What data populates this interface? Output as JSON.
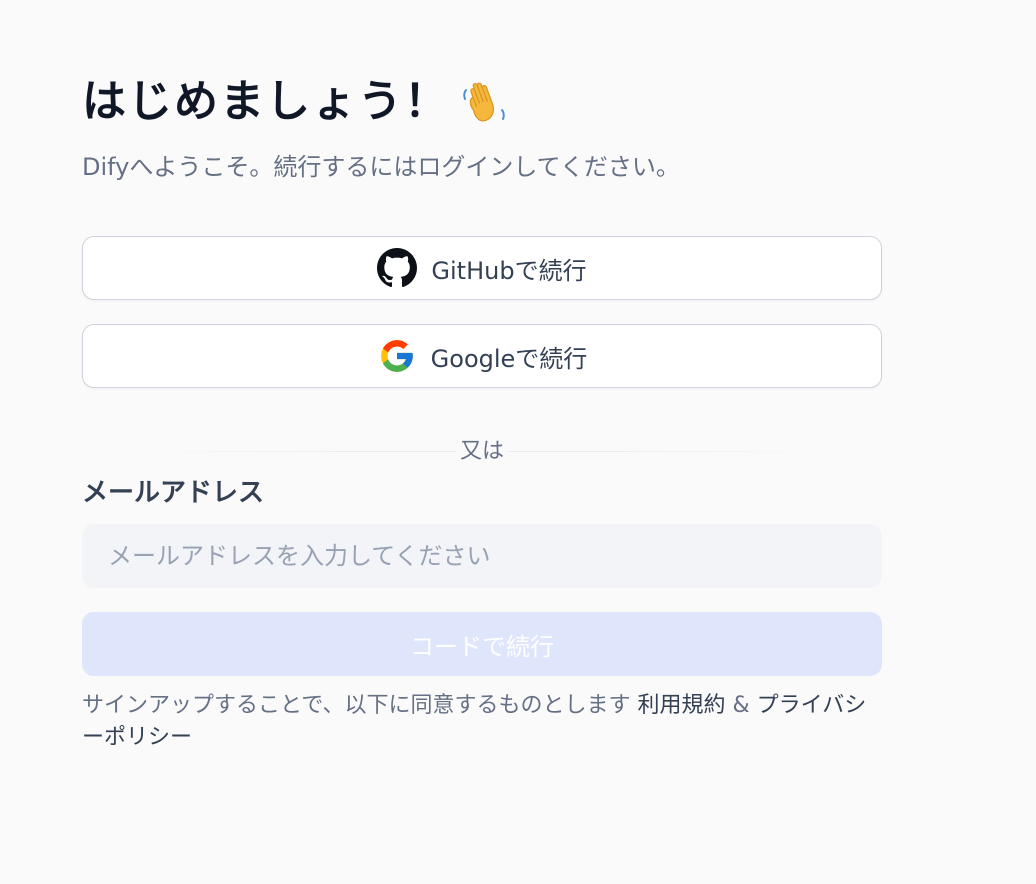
{
  "header": {
    "title": "はじめましょう！",
    "title_icon": "waving-hand-emoji",
    "subtitle": "Difyへようこそ。続行するにはログインしてください。"
  },
  "oauth": {
    "github": {
      "label": "GitHubで続行",
      "icon": "github-icon"
    },
    "google": {
      "label": "Googleで続行",
      "icon": "google-icon"
    }
  },
  "divider": {
    "text": "又は"
  },
  "email": {
    "label": "メールアドレス",
    "placeholder": "メールアドレスを入力してください",
    "value": ""
  },
  "submit": {
    "label": "コードで続行"
  },
  "terms": {
    "prefix": "サインアップすることで、以下に同意するものとします ",
    "terms_link": "利用規約",
    "separator": " & ",
    "privacy_link": "プライバシーポリシー"
  },
  "colors": {
    "background": "#fafafa",
    "title": "#101828",
    "muted": "#667085",
    "input_bg": "#f2f4f7",
    "primary_disabled": "#dfe6fb"
  }
}
